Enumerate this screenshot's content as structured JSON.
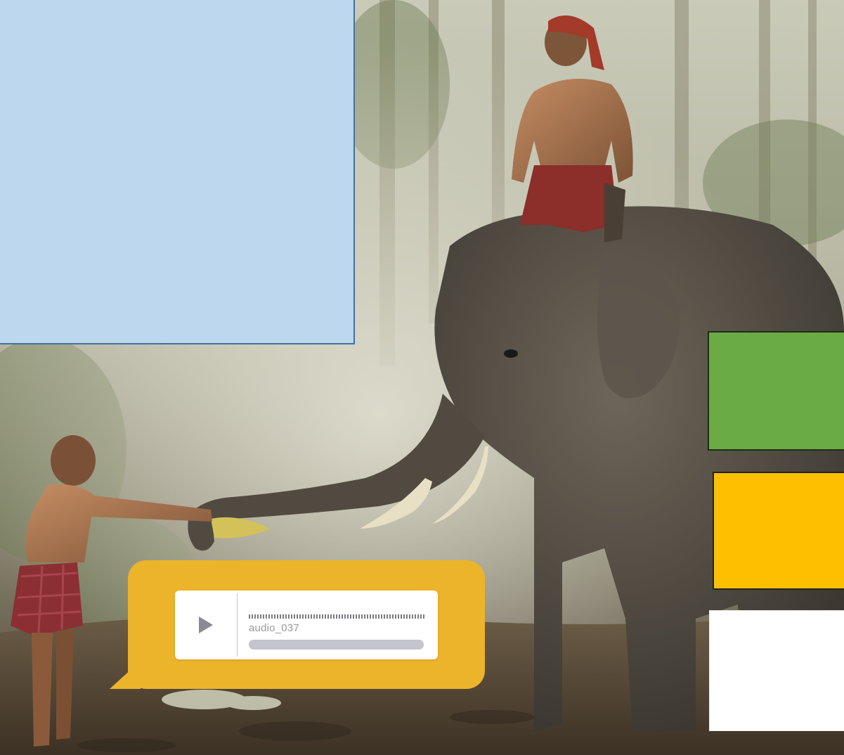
{
  "scene": {
    "photo_subject": "elephant-with-rider-and-boy",
    "colors": {
      "blue_panel": "#bdd7ee",
      "green_square": "#6bab45",
      "yellow_square": "#fdbf00",
      "white_square": "#ffffff",
      "bubble": "#ecb42a"
    }
  },
  "audio": {
    "label": "audio_037",
    "progress": 0,
    "play_icon": "play-icon"
  }
}
